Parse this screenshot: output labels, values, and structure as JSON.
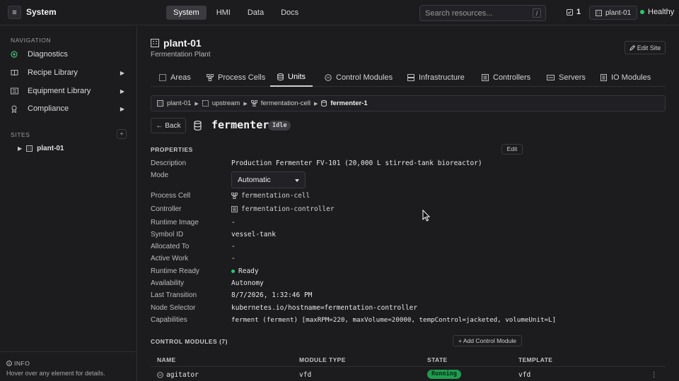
{
  "app": {
    "title": "System",
    "menu_glyph": "≡"
  },
  "topnav": [
    {
      "label": "System",
      "active": true
    },
    {
      "label": "HMI",
      "active": false
    },
    {
      "label": "Data",
      "active": false
    },
    {
      "label": "Docs",
      "active": false
    }
  ],
  "search": {
    "placeholder": "Search resources...",
    "shortcut": "/"
  },
  "status": {
    "alert_count": "1",
    "site": "plant-01",
    "health": "Healthy",
    "health_color": "#34c36b"
  },
  "sidebar": {
    "navigation_label": "NAVIGATION",
    "items": [
      {
        "label": "Diagnostics",
        "icon": "target-icon",
        "expandable": false
      },
      {
        "label": "Recipe Library",
        "icon": "book-icon",
        "expandable": true
      },
      {
        "label": "Equipment Library",
        "icon": "equipment-icon",
        "expandable": true
      },
      {
        "label": "Compliance",
        "icon": "award-icon",
        "expandable": true
      }
    ],
    "sites_label": "SITES",
    "add_site": "+",
    "sites": [
      {
        "label": "plant-01"
      }
    ]
  },
  "info": {
    "title": "INFO",
    "text": "Hover over any element for details."
  },
  "site": {
    "name": "plant-01",
    "subtitle": "Fermentation Plant",
    "edit_label": "Edit Site"
  },
  "tabs": [
    {
      "label": "Areas",
      "icon": "areas-icon"
    },
    {
      "label": "Process Cells",
      "icon": "process-cell-icon"
    },
    {
      "label": "Units",
      "icon": "unit-icon",
      "active": true
    },
    {
      "label": "Control Modules",
      "icon": "control-module-icon"
    },
    {
      "label": "Infrastructure",
      "icon": "infrastructure-icon"
    },
    {
      "label": "Controllers",
      "icon": "controller-icon"
    },
    {
      "label": "Servers",
      "icon": "server-icon"
    },
    {
      "label": "IO Modules",
      "icon": "io-module-icon"
    }
  ],
  "breadcrumb": [
    "plant-01",
    "upstream",
    "fermentation-cell",
    "fermenter-1"
  ],
  "unit": {
    "back_label": "← Back",
    "name": "fermenter-1",
    "state": "Idle"
  },
  "properties": {
    "heading": "PROPERTIES",
    "edit_label": "Edit",
    "description_label": "Description",
    "description": "Production Fermenter FV-101 (20,000 L stirred-tank bioreactor)",
    "mode_label": "Mode",
    "mode": "Automatic",
    "process_cell_label": "Process Cell",
    "process_cell": "fermentation-cell",
    "controller_label": "Controller",
    "controller": "fermentation-controller",
    "runtime_image_label": "Runtime Image",
    "runtime_image": "-",
    "symbol_id_label": "Symbol ID",
    "symbol_id": "vessel-tank",
    "allocated_to_label": "Allocated To",
    "allocated_to": "-",
    "active_work_label": "Active Work",
    "active_work": "-",
    "runtime_ready_label": "Runtime Ready",
    "runtime_ready": "Ready",
    "availability_label": "Availability",
    "availability": "Autonomy",
    "last_transition_label": "Last Transition",
    "last_transition": "8/7/2026, 1:32:46 PM",
    "node_selector_label": "Node Selector",
    "node_selector": "kubernetes.io/hostname=fermentation-controller",
    "capabilities_label": "Capabilities",
    "capabilities": "ferment (ferment) [maxRPM=220, maxVolume=20000, tempControl=jacketed, volumeUnit=L]"
  },
  "control_modules": {
    "heading": "CONTROL MODULES (7)",
    "add_label": "+ Add Control Module",
    "columns": [
      "NAME",
      "MODULE TYPE",
      "STATE",
      "TEMPLATE"
    ],
    "rows": [
      {
        "name": "agitator",
        "module_type": "vfd",
        "state": "Running",
        "template": "vfd"
      }
    ]
  }
}
